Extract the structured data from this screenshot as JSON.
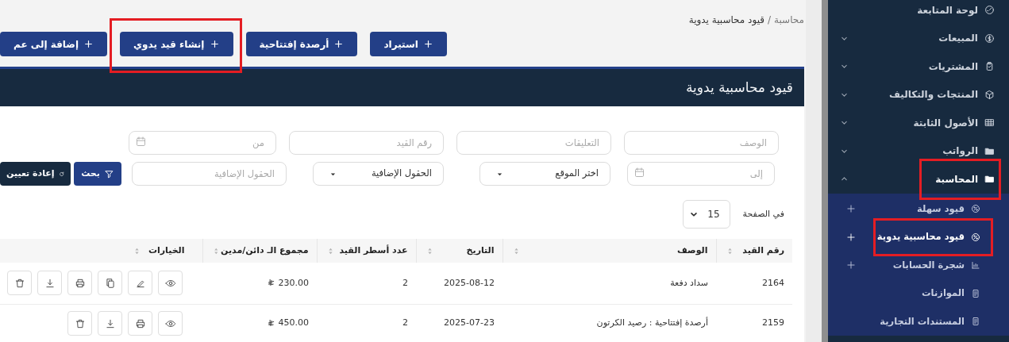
{
  "sidebar": {
    "items": [
      {
        "label": "لوحة المتابعة",
        "kind": "link",
        "highlighted": false
      },
      {
        "label": "المبيعات",
        "kind": "group",
        "expanded": false,
        "highlighted": false
      },
      {
        "label": "المشتريات",
        "kind": "group",
        "expanded": false,
        "highlighted": false
      },
      {
        "label": "المنتجات والتكاليف",
        "kind": "group",
        "expanded": false,
        "highlighted": false
      },
      {
        "label": "الأصول الثابتة",
        "kind": "group",
        "expanded": false,
        "highlighted": false
      },
      {
        "label": "الرواتب",
        "kind": "group",
        "expanded": false,
        "highlighted": false
      },
      {
        "label": "المحاسبة",
        "kind": "group",
        "expanded": true,
        "highlighted": true,
        "children": [
          {
            "label": "قيود سهلة",
            "selected": false,
            "add_button": true,
            "highlighted": false
          },
          {
            "label": "قيود محاسبية يدوية",
            "selected": true,
            "add_button": true,
            "highlighted": true
          },
          {
            "label": "شجرة الحسابات",
            "selected": false,
            "add_button": true,
            "highlighted": false
          },
          {
            "label": "الموازنات",
            "selected": false,
            "add_button": false,
            "highlighted": false
          },
          {
            "label": "المستندات التجارية",
            "selected": false,
            "add_button": false,
            "highlighted": false
          }
        ]
      }
    ]
  },
  "breadcrumb": {
    "separator": "/",
    "items": [
      {
        "label": "محاسبة",
        "current": false
      },
      {
        "label": "قيود محاسبية يدوية",
        "current": true
      }
    ]
  },
  "actions": [
    {
      "label": "استيراد",
      "highlighted": false
    },
    {
      "label": "أرصدة إفتتاحية",
      "highlighted": false
    },
    {
      "label": "إنشاء قيد يدوي",
      "highlighted": true
    },
    {
      "label": "إضافة إلى عم",
      "highlighted": false
    }
  ],
  "card": {
    "title": "قيود محاسبية يدوية"
  },
  "filters": {
    "rows": [
      {
        "fields": [
          {
            "kind": "text",
            "placeholder": "الوصف"
          },
          {
            "kind": "text",
            "placeholder": "التعليقات"
          },
          {
            "kind": "text",
            "placeholder": "رقم القيد"
          },
          {
            "kind": "date",
            "placeholder": "من"
          }
        ]
      },
      {
        "fields": [
          {
            "kind": "date",
            "placeholder": "إلى"
          },
          {
            "kind": "select",
            "value": "اختر الموقع"
          },
          {
            "kind": "select",
            "value": "الحقول الإضافية"
          },
          {
            "kind": "text",
            "placeholder": "الحقول الإضافية"
          },
          {
            "kind": "search",
            "label": "بحث"
          },
          {
            "kind": "reset",
            "label": "إعادة تعيين"
          }
        ]
      }
    ]
  },
  "pagination": {
    "label": "في الصفحة",
    "value": "15"
  },
  "table": {
    "columns": [
      {
        "label": "رقم القيد",
        "sortable": true
      },
      {
        "label": "الوصف",
        "sortable": true
      },
      {
        "label": "التاريخ",
        "sortable": true
      },
      {
        "label": "عدد أسطر القيد",
        "sortable": true
      },
      {
        "label": "مجموع الـ دائن/مدين",
        "sortable": true
      },
      {
        "label": "الخيارات",
        "sortable": true
      }
    ],
    "rows": [
      {
        "cells": [
          "2164",
          "سداد دفعة",
          "2025-08-12",
          "2",
          "230.00"
        ],
        "actions": [
          {
            "kind": "view"
          },
          {
            "kind": "edit"
          },
          {
            "kind": "copy"
          },
          {
            "kind": "print"
          },
          {
            "kind": "download"
          },
          {
            "kind": "delete"
          }
        ]
      },
      {
        "cells": [
          "2159",
          "أرصدة إفتتاحية : رصيد الكرتون",
          "2025-07-23",
          "2",
          "450.00"
        ],
        "actions": [
          {
            "kind": "view"
          },
          {
            "kind": "print"
          },
          {
            "kind": "download"
          },
          {
            "kind": "delete"
          }
        ]
      }
    ]
  }
}
